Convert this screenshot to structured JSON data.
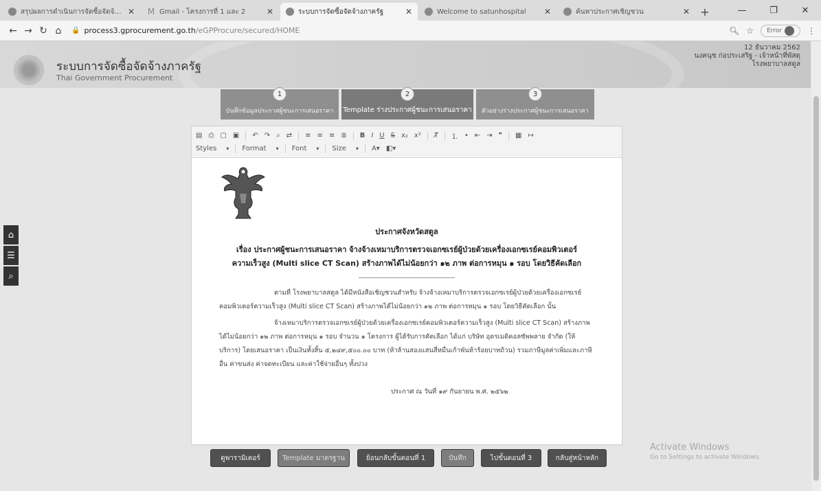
{
  "browser": {
    "tabs": [
      {
        "title": "สรุปผลการดำเนินการจัดซื้อจัดจ้าง (รา",
        "active": false
      },
      {
        "title": "Gmail - โครงการที่ 1 และ 2",
        "active": false
      },
      {
        "title": "ระบบการจัดซื้อจัดจ้างภาครัฐ",
        "active": true
      },
      {
        "title": "Welcome to satunhospital",
        "active": false
      },
      {
        "title": "ค้นหาประกาศเชิญชวน",
        "active": false
      }
    ],
    "url_host": "process3.gprocurement.go.th",
    "url_path": "/eGPProcure/secured/HOME",
    "profile_label": "Error"
  },
  "header": {
    "title": "ระบบการจัดซื้อจัดจ้างภาครัฐ",
    "subtitle": "Thai Government Procurement",
    "date": "12 ธันวาคม 2562",
    "user": "นงคนุช ก่อประเสริฐ - เจ้าหน้าที่พัสดุ",
    "org": "โรงพยาบาลสตูล"
  },
  "steps": [
    {
      "num": "1",
      "label": "บันทึกข้อมูลประกาศผู้ชนะการเสนอราคา",
      "active": false
    },
    {
      "num": "2",
      "label": "Template ร่างประกาศผู้ชนะการเสนอราคา",
      "active": true
    },
    {
      "num": "3",
      "label": "ตัวอย่างร่างประกาศผู้ชนะการเสนอราคา",
      "active": false
    }
  ],
  "editor": {
    "toolbar": {
      "styles": "Styles",
      "format": "Format",
      "font": "Font",
      "size": "Size"
    }
  },
  "document": {
    "org": "ประกาศจังหวัดสตูล",
    "subject": "เรื่อง ประกาศผู้ชนะการเสนอราคา จ้างจ้างเหมาบริการตรวจเอกซเรย์ผู้ป่วยด้วยเครื่องเอกซเรย์คอมพิวเตอร์ความเร็วสูง (Multi slice CT Scan) สร้างภาพได้ไม่น้อยกว่า ๑๒ ภาพ ต่อการหมุน ๑ รอบ โดยวิธีคัดเลือก",
    "para1": "ตามที่ โรงพยาบาลสตูล ได้มีหนังสือเชิญชวนสำหรับ จ้างจ้างเหมาบริการตรวจเอกซเรย์ผู้ป่วยด้วยเครื่องเอกซเรย์คอมพิวเตอร์ความเร็วสูง (Multi slice CT Scan) สร้างภาพได้ไม่น้อยกว่า ๑๒ ภาพ ต่อการหมุน ๑ รอบ โดยวิธีคัดเลือก นั้น",
    "para2": "จ้างเหมาบริการตรวจเอกซเรย์ผู้ป่วยด้วยเครื่องเอกซเรย์คอมพิวเตอร์ความเร็วสูง (Multi slice CT Scan) สร้างภาพได้ไม่น้อยกว่า ๑๒ ภาพ ต่อการหมุน ๑ รอบ จำนวน ๑ โครงการ ผู้ได้รับการคัดเลือก ได้แก่ บริษัท อุดรเมดิคอลซัพพลาย จำกัด (ให้บริการ) โดยเสนอราคา เป็นเงินทั้งสิ้น ๕,๒๔๙,๕๐๐.๐๐ บาท (ห้าล้านสองแสนสี่หมื่นเก้าพันห้าร้อยบาทถ้วน) รวมภาษีมูลค่าเพิ่มและภาษีอื่น ค่าขนส่ง ค่าจดทะเบียน และค่าใช้จ่ายอื่นๆ ทั้งปวง",
    "date": "ประกาศ ณ วันที่ ๑๙ กันยายน พ.ศ. ๒๕๖๒"
  },
  "buttons": [
    {
      "label": "ดูพารามิเตอร์",
      "dim": false
    },
    {
      "label": "Template มาตรฐาน",
      "dim": true
    },
    {
      "label": "ย้อนกลับขั้นตอนที่ 1",
      "dim": false
    },
    {
      "label": "บันทึก",
      "dim": true
    },
    {
      "label": "ไปขั้นตอนที่ 3",
      "dim": false
    },
    {
      "label": "กลับสู่หน้าหลัก",
      "dim": false
    }
  ],
  "watermark": {
    "line1": "Activate Windows",
    "line2": "Go to Settings to activate Windows."
  }
}
